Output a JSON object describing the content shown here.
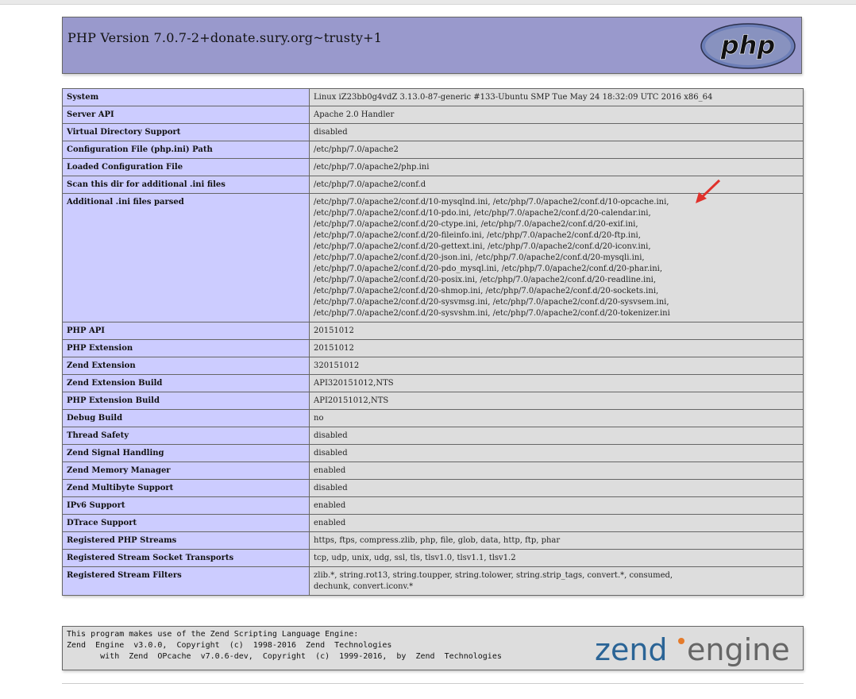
{
  "header": {
    "title": "PHP Version 7.0.7-2+donate.sury.org~trusty+1",
    "logo_text": "php"
  },
  "info_rows": [
    {
      "label": "System",
      "value": [
        "Linux iZ23bb0g4vdZ 3.13.0-87-generic #133-Ubuntu SMP Tue May 24 18:32:09 UTC 2016 x86_64"
      ]
    },
    {
      "label": "Server API",
      "value": [
        "Apache 2.0 Handler"
      ]
    },
    {
      "label": "Virtual Directory Support",
      "value": [
        "disabled"
      ]
    },
    {
      "label": "Configuration File (php.ini) Path",
      "value": [
        "/etc/php/7.0/apache2"
      ]
    },
    {
      "label": "Loaded Configuration File",
      "value": [
        "/etc/php/7.0/apache2/php.ini"
      ]
    },
    {
      "label": "Scan this dir for additional .ini files",
      "value": [
        "/etc/php/7.0/apache2/conf.d"
      ]
    },
    {
      "label": "Additional .ini files parsed",
      "value": [
        "/etc/php/7.0/apache2/conf.d/10-mysqlnd.ini, /etc/php/7.0/apache2/conf.d/10-opcache.ini,",
        "/etc/php/7.0/apache2/conf.d/10-pdo.ini, /etc/php/7.0/apache2/conf.d/20-calendar.ini,",
        "/etc/php/7.0/apache2/conf.d/20-ctype.ini, /etc/php/7.0/apache2/conf.d/20-exif.ini,",
        "/etc/php/7.0/apache2/conf.d/20-fileinfo.ini, /etc/php/7.0/apache2/conf.d/20-ftp.ini,",
        "/etc/php/7.0/apache2/conf.d/20-gettext.ini, /etc/php/7.0/apache2/conf.d/20-iconv.ini,",
        "/etc/php/7.0/apache2/conf.d/20-json.ini, /etc/php/7.0/apache2/conf.d/20-mysqli.ini,",
        "/etc/php/7.0/apache2/conf.d/20-pdo_mysql.ini, /etc/php/7.0/apache2/conf.d/20-phar.ini,",
        "/etc/php/7.0/apache2/conf.d/20-posix.ini, /etc/php/7.0/apache2/conf.d/20-readline.ini,",
        "/etc/php/7.0/apache2/conf.d/20-shmop.ini, /etc/php/7.0/apache2/conf.d/20-sockets.ini,",
        "/etc/php/7.0/apache2/conf.d/20-sysvmsg.ini, /etc/php/7.0/apache2/conf.d/20-sysvsem.ini,",
        "/etc/php/7.0/apache2/conf.d/20-sysvshm.ini, /etc/php/7.0/apache2/conf.d/20-tokenizer.ini"
      ]
    },
    {
      "label": "PHP API",
      "value": [
        "20151012"
      ]
    },
    {
      "label": "PHP Extension",
      "value": [
        "20151012"
      ]
    },
    {
      "label": "Zend Extension",
      "value": [
        "320151012"
      ]
    },
    {
      "label": "Zend Extension Build",
      "value": [
        "API320151012,NTS"
      ]
    },
    {
      "label": "PHP Extension Build",
      "value": [
        "API20151012,NTS"
      ]
    },
    {
      "label": "Debug Build",
      "value": [
        "no"
      ]
    },
    {
      "label": "Thread Safety",
      "value": [
        "disabled"
      ]
    },
    {
      "label": "Zend Signal Handling",
      "value": [
        "disabled"
      ]
    },
    {
      "label": "Zend Memory Manager",
      "value": [
        "enabled"
      ]
    },
    {
      "label": "Zend Multibyte Support",
      "value": [
        "disabled"
      ]
    },
    {
      "label": "IPv6 Support",
      "value": [
        "enabled"
      ]
    },
    {
      "label": "DTrace Support",
      "value": [
        "enabled"
      ]
    },
    {
      "label": "Registered PHP Streams",
      "value": [
        "https, ftps, compress.zlib, php, file, glob, data, http, ftp, phar"
      ]
    },
    {
      "label": "Registered Stream Socket Transports",
      "value": [
        "tcp, udp, unix, udg, ssl, tls, tlsv1.0, tlsv1.1, tlsv1.2"
      ]
    },
    {
      "label": "Registered Stream Filters",
      "value": [
        "zlib.*, string.rot13, string.toupper, string.tolower, string.strip_tags, convert.*, consumed,",
        "dechunk, convert.iconv.*"
      ]
    }
  ],
  "zend": {
    "line1": "This program makes use of the Zend Scripting Language Engine:",
    "line2": "Zend  Engine  v3.0.0,  Copyright  (c)  1998-2016  Zend  Technologies",
    "line3": "       with  Zend  OPcache  v7.0.6-dev,  Copyright  (c)  1999-2016,  by  Zend  Technologies",
    "logo_left": "zend",
    "logo_right": "engine"
  },
  "colors": {
    "header_bg": "#9999cc",
    "label_bg": "#ccccff",
    "value_bg": "#dddddd",
    "annotation_arrow": "#e0312b"
  }
}
